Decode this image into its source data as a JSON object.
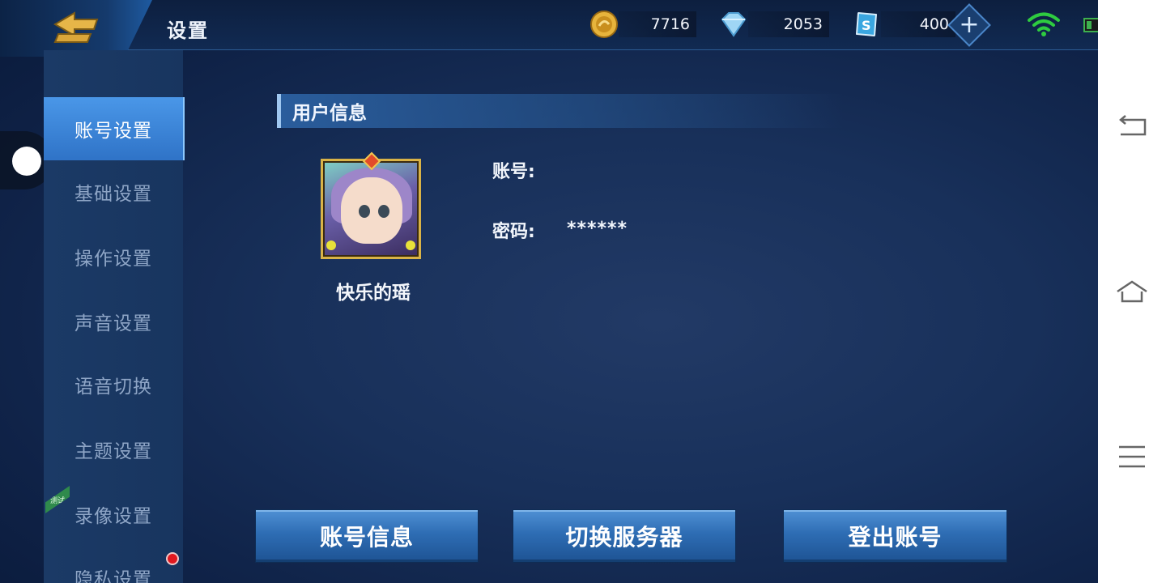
{
  "header": {
    "title": "设置",
    "currencies": [
      {
        "icon": "gold-coin-icon",
        "value": "7716"
      },
      {
        "icon": "diamond-icon",
        "value": "2053"
      },
      {
        "icon": "coupon-icon",
        "value": "400"
      }
    ],
    "add_icon": "plus-icon"
  },
  "sidebar": {
    "items": [
      {
        "label": "账号设置",
        "active": true
      },
      {
        "label": "基础设置",
        "active": false
      },
      {
        "label": "操作设置",
        "active": false
      },
      {
        "label": "声音设置",
        "active": false
      },
      {
        "label": "语音切换",
        "active": false
      },
      {
        "label": "主题设置",
        "active": false
      },
      {
        "label": "录像设置",
        "active": false
      },
      {
        "label": "隐私设置",
        "active": false
      }
    ],
    "test_badge": "测试"
  },
  "user_info": {
    "section_title": "用户信息",
    "nickname": "快乐的瑶",
    "account_label": "账号:",
    "password_label": "密码:",
    "password_value": "******"
  },
  "actions": {
    "account_info": "账号信息",
    "switch_server": "切换服务器",
    "logout": "登出账号"
  },
  "colors": {
    "accent": "#3f86d6",
    "wifi": "#2ecc40",
    "notification": "#e0181f"
  }
}
